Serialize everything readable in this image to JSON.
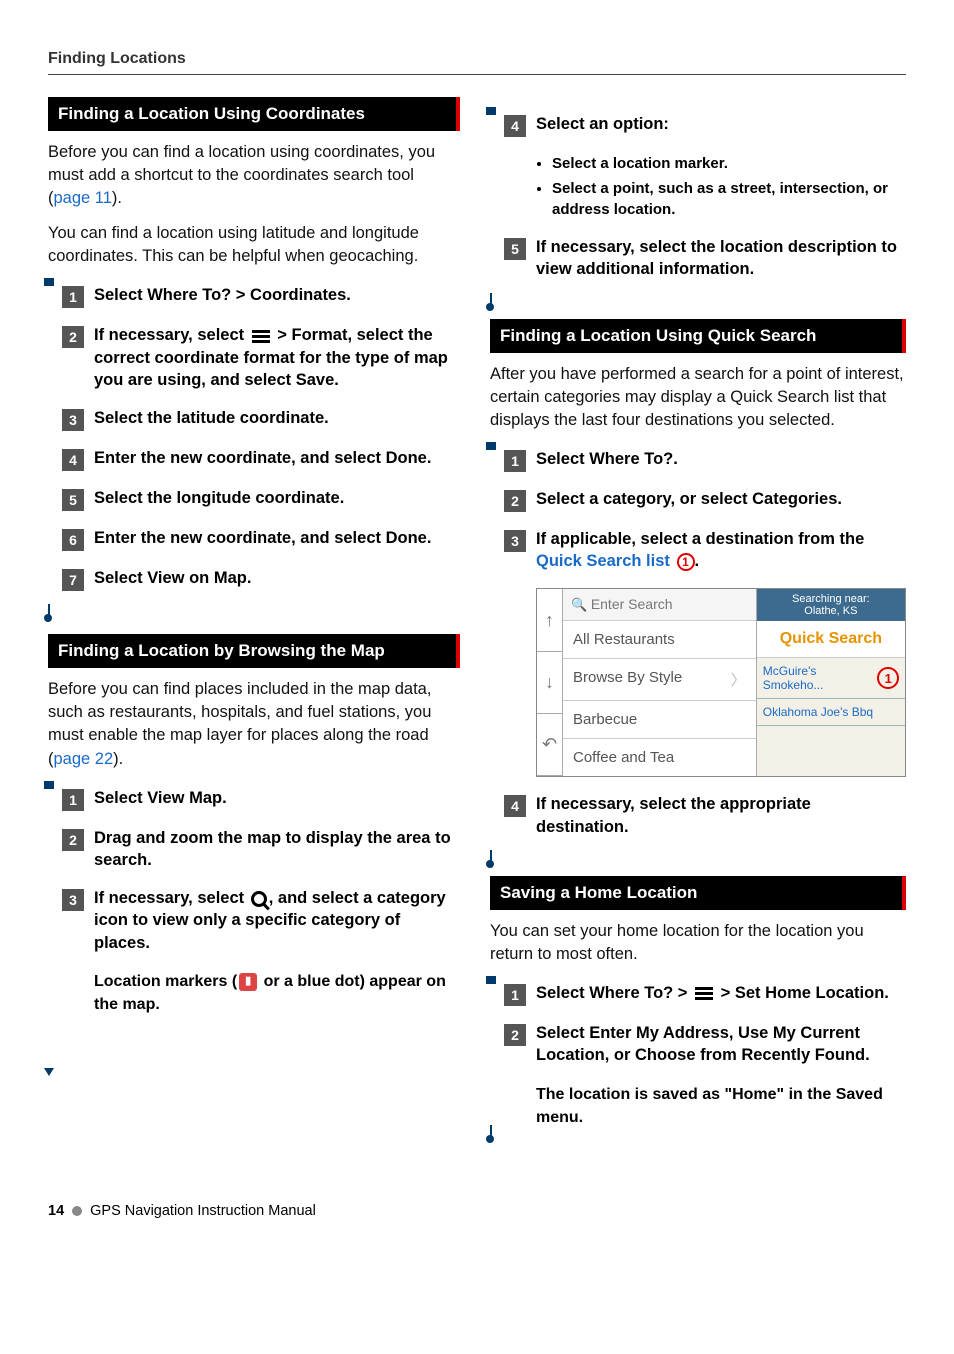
{
  "header": {
    "section_title": "Finding Locations"
  },
  "left": {
    "sec1": {
      "title": "Finding a Location Using Coordinates",
      "intro1a": "Before you can find a location using coordinates, you must add a shortcut to the coordinates search tool (",
      "intro1_link": "page 11",
      "intro1b": ").",
      "intro2": "You can find a location using latitude and longitude coordinates. This can be helpful when geocaching.",
      "steps": [
        "Select Where To? > Coordinates.",
        "If necessary, select [MENU] > Format, select the correct coordinate format for the type of map you are using, and select Save.",
        "Select the latitude coordinate.",
        "Enter the new coordinate, and select Done.",
        "Select the longitude coordinate.",
        "Enter the new coordinate, and select Done.",
        "Select View on Map."
      ]
    },
    "sec2": {
      "title": "Finding a Location by Browsing the Map",
      "intro_a": "Before you can find places included in the map data, such as restaurants, hospitals, and fuel stations, you must enable the map layer for places along the road (",
      "intro_link": "page 22",
      "intro_b": ").",
      "steps": [
        "Select View Map.",
        "Drag and zoom the map to display the area to search.",
        "If necessary, select [MAG], and select a category icon to view only a specific category of places."
      ],
      "sub": "Location markers ( [PIN] or a blue dot) appear on the map."
    }
  },
  "right": {
    "sec2_cont": {
      "step4": "Select an option:",
      "bullets": [
        "Select a location marker.",
        "Select a point, such as a street, intersection, or address location."
      ],
      "step5": "If necessary, select the location description to view additional information."
    },
    "sec3": {
      "title": "Finding a Location Using Quick Search",
      "intro": "After you have performed a search for a point of interest, certain categories may display a Quick Search list that displays the last four destinations you selected.",
      "steps": {
        "s1": "Select Where To?.",
        "s2": "Select a category, or select Categories.",
        "s3a": "If applicable, select a destination from the ",
        "s3b": "Quick Search list",
        "s4": "If necessary, select the appropriate destination."
      }
    },
    "mock": {
      "search_placeholder": "Enter Search",
      "rows": [
        "All Restaurants",
        "Browse By Style",
        "Barbecue",
        "Coffee and Tea"
      ],
      "right_head": "Searching near:\nOlathe, KS",
      "qs_label": "Quick Search",
      "qs_items": [
        "McGuire's Smokeho...",
        "Oklahoma Joe's Bbq"
      ],
      "ring": "1"
    },
    "sec4": {
      "title": "Saving a Home Location",
      "intro": "You can set your home location for the location you return to most often.",
      "step1": "Select Where To? > [MENU] > Set Home Location.",
      "step2": "Select Enter My Address, Use My Current Location, or Choose from Recently Found.",
      "sub": "The location is saved as \"Home\" in the Saved menu."
    }
  },
  "footer": {
    "page_num": "14",
    "manual": "GPS Navigation Instruction Manual"
  }
}
